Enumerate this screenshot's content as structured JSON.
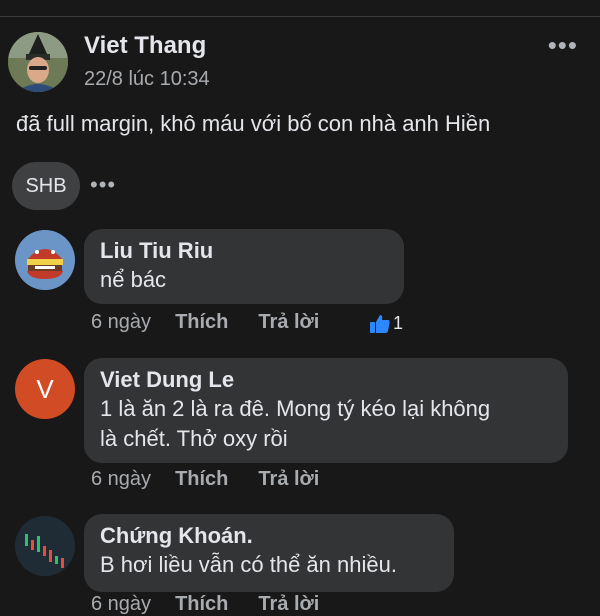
{
  "post": {
    "author": "Viet Thang",
    "time": "22/8 lúc 10:34",
    "more": "•••",
    "text": "đã full margin, khô máu với bố con nhà anh Hiền",
    "tag": "SHB",
    "tag_more": "•••"
  },
  "comments": [
    {
      "author": "Liu Tiu Riu",
      "text_lines": [
        "nể bác"
      ],
      "time": "6 ngày",
      "like": "Thích",
      "reply": "Trả lời",
      "reaction_count": "1"
    },
    {
      "author": "Viet Dung Le",
      "avatar_letter": "V",
      "text_lines": [
        "1 là ăn 2 là ra đê. Mong tý kéo lại không",
        "là chết. Thở oxy rồi"
      ],
      "time": "6 ngày",
      "like": "Thích",
      "reply": "Trả lời"
    },
    {
      "author": "Chứng Khoán.",
      "text_lines": [
        "B hơi liều vẫn có thể ăn nhiều."
      ],
      "time": "6 ngày",
      "like": "Thích",
      "reply": "Trả lời"
    }
  ],
  "colors": {
    "background": "#181818",
    "bubble": "#333436",
    "like_blue": "#2d88ff",
    "avatar_red": "#d14b24"
  }
}
